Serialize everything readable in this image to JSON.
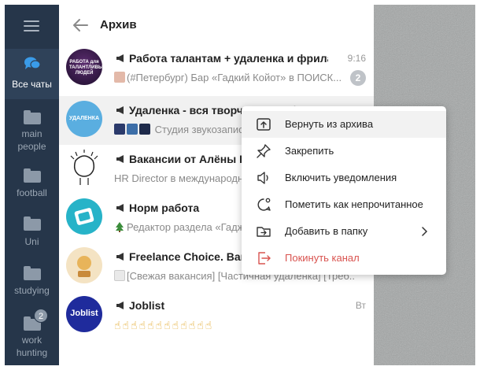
{
  "rail": {
    "items": [
      {
        "label": "Все чаты",
        "icon": "chats-icon",
        "active": true
      },
      {
        "label": "main\npeople",
        "icon": "folder-icon"
      },
      {
        "label": "football",
        "icon": "folder-icon"
      },
      {
        "label": "Uni",
        "icon": "folder-icon"
      },
      {
        "label": "studying",
        "icon": "folder-icon"
      },
      {
        "label": "work\nhunting",
        "icon": "folder-icon",
        "badge": "2"
      }
    ]
  },
  "header": {
    "title": "Архив"
  },
  "chats": [
    {
      "name": "Работа талантам + удаленка и фриланс",
      "time": "9:16",
      "preview": "(#Петербург) Бар «Гадкий Койот» в ПОИСК...",
      "badge": "2"
    },
    {
      "name": "Удаленка - вся творческая работа",
      "time": "",
      "preview": "Студия звукозаписи"
    },
    {
      "name": "Вакансии от Алёны Владимировой",
      "time": "",
      "preview": "HR Director в международную компанию"
    },
    {
      "name": "Норм работа",
      "time": "",
      "preview": "Редактор раздела «Гаджеты»"
    },
    {
      "name": "Freelance Choice. Вакансии",
      "time": "",
      "preview": "[Свежая вакансия] [Частичная удаленка] [Треб..."
    },
    {
      "name": "Joblist",
      "time": "Вт",
      "preview": "☝☝☝☝☝☝☝☝☝☝☝☝"
    }
  ],
  "avatars": {
    "rabota_text": "РАБОТА для ТАЛАНТЛИВЫХ ЛЮДЕЙ",
    "udalenka_text": "УДАЛЕНКА",
    "joblist_text": "Joblist"
  },
  "menu": {
    "items": [
      {
        "label": "Вернуть из архива",
        "icon": "unarchive-icon"
      },
      {
        "label": "Закрепить",
        "icon": "pin-icon"
      },
      {
        "label": "Включить уведомления",
        "icon": "speaker-icon"
      },
      {
        "label": "Пометить как непрочитанное",
        "icon": "unread-icon"
      },
      {
        "label": "Добавить в папку",
        "icon": "folder-add-icon"
      },
      {
        "label": "Покинуть канал",
        "icon": "leave-icon"
      }
    ]
  },
  "colors": {
    "rail_bg": "#26364a",
    "accent": "#3a8fd9",
    "danger": "#d9534f"
  }
}
